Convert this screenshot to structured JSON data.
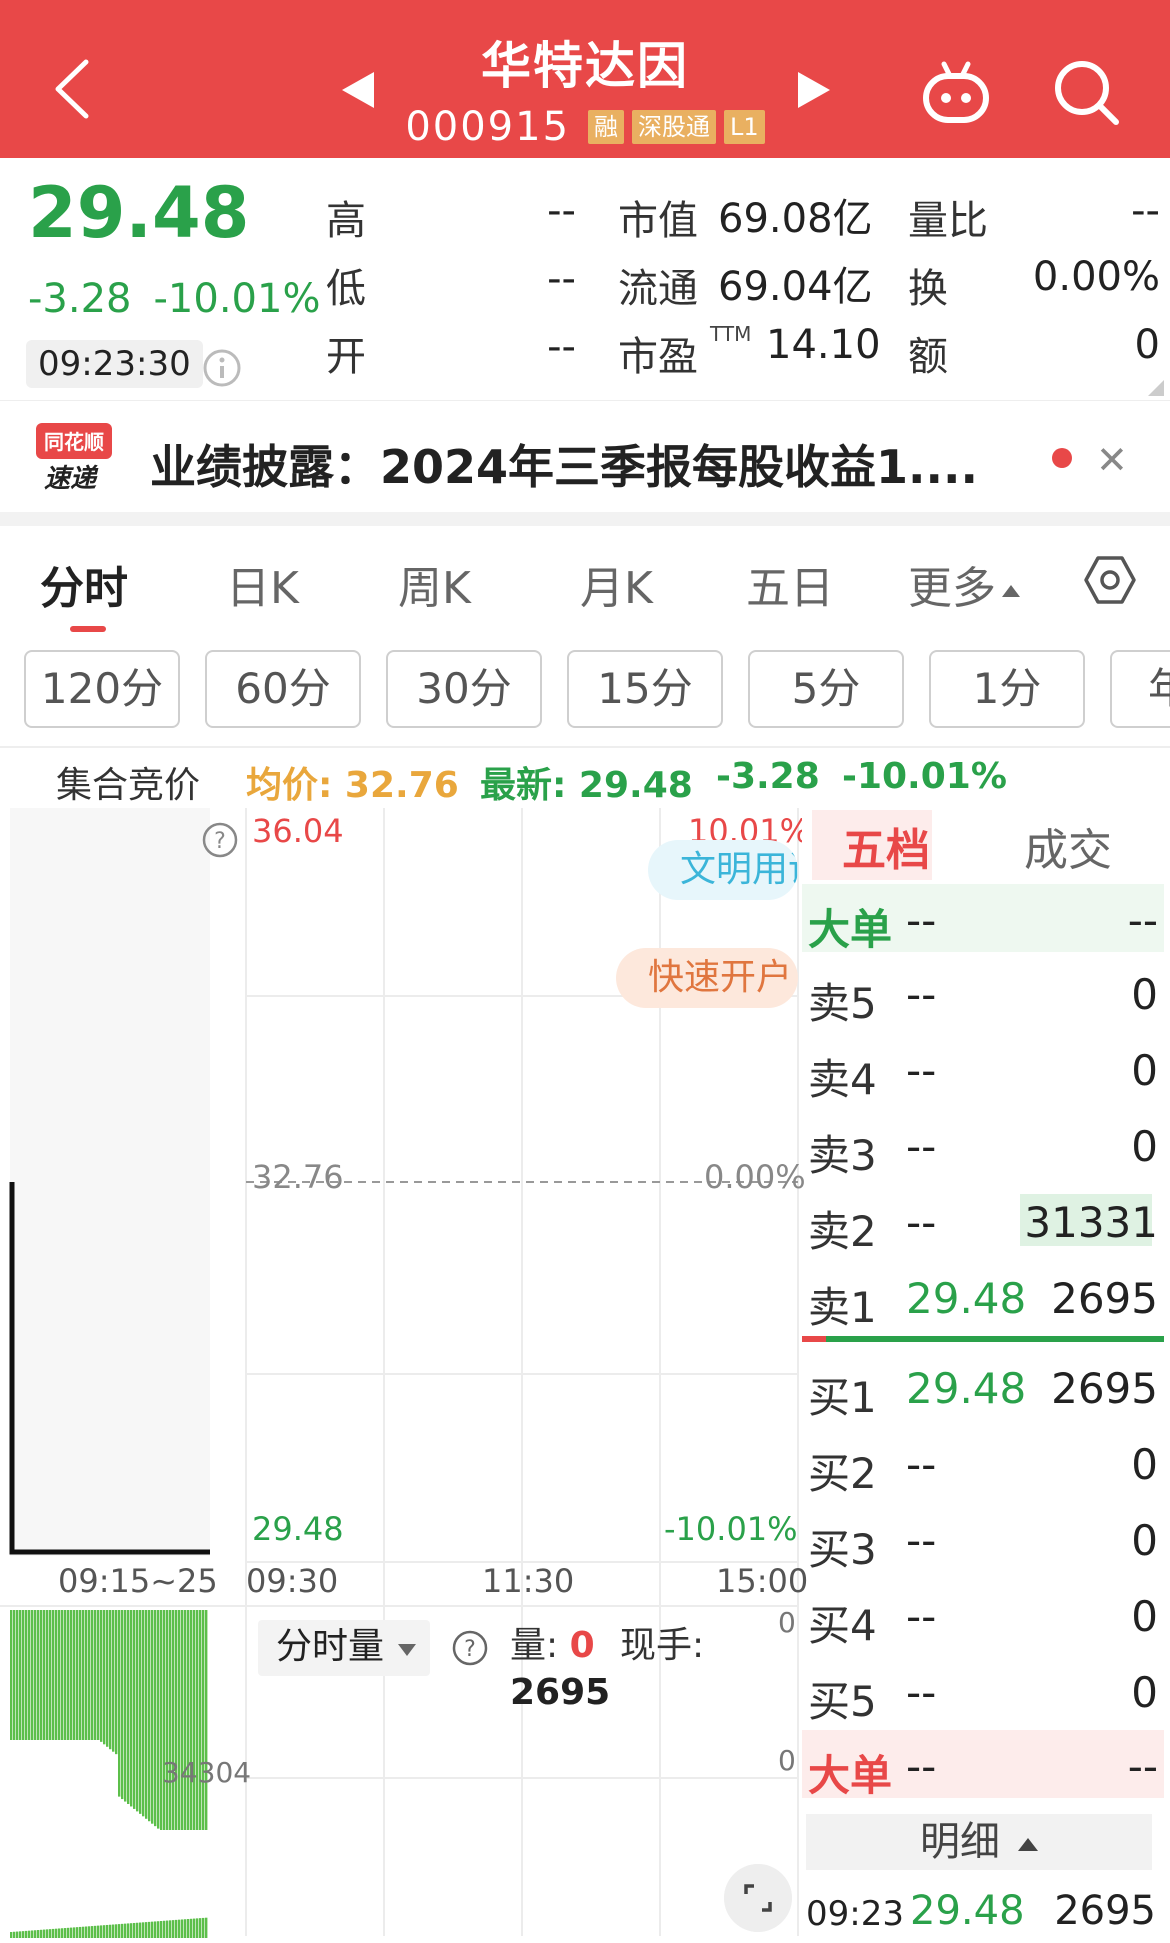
{
  "header": {
    "title": "华特达因",
    "code": "000915",
    "badges": [
      "融",
      "深股通",
      "L1"
    ],
    "bg_color": "#e84848"
  },
  "quote": {
    "price": "29.48",
    "change": "-3.28",
    "change_pct": "-10.01%",
    "time": "09:23:30",
    "fields": [
      {
        "label": "高",
        "value": "--"
      },
      {
        "label": "低",
        "value": "--"
      },
      {
        "label": "开",
        "value": "--"
      },
      {
        "label": "市值",
        "value": "69.08亿"
      },
      {
        "label": "流通",
        "value": "69.04亿"
      },
      {
        "label": "市盈",
        "sup": "TTM",
        "value": "14.10"
      },
      {
        "label": "量比",
        "value": "--"
      },
      {
        "label": "换",
        "value": "0.00%"
      },
      {
        "label": "额",
        "value": "0"
      }
    ],
    "down_color": "#2aa14a"
  },
  "news": {
    "logo_top": "同花顺",
    "logo_bottom": "速递",
    "text": "业绩披露：2024年三季报每股收益1...."
  },
  "period_tabs": [
    "分时",
    "日K",
    "周K",
    "月K",
    "五日",
    "更多"
  ],
  "minute_buttons": [
    "120分",
    "60分",
    "30分",
    "15分",
    "5分",
    "1分",
    "年"
  ],
  "avg_row": {
    "label": "集合竞价",
    "avg": "均价: 32.76",
    "latest": "最新: 29.48",
    "chg": "-3.28",
    "pct": "-10.01%"
  },
  "chart": {
    "y_top": "36.04",
    "y_mid": "32.76",
    "y_bottom": "29.48",
    "pct_top": "10.01%",
    "pct_mid": "0.00%",
    "pct_bottom": "-10.01%",
    "times": [
      "09:15~25",
      "09:30",
      "11:30",
      "15:00"
    ],
    "pill_1": "文明用语",
    "pill_2": "快速开户",
    "vol_label_auction": "34304",
    "vol_axis_top": "0",
    "vol_axis_mid": "0"
  },
  "chart_data": {
    "type": "line",
    "title": "",
    "x": [
      "09:15~25",
      "09:30",
      "11:30",
      "15:00"
    ],
    "ylim": [
      29.48,
      36.04
    ],
    "pct_range": [
      "-10.01%",
      "10.01%"
    ],
    "reference_price": 32.76,
    "series": [
      {
        "name": "",
        "values": [
          29.48
        ]
      }
    ]
  },
  "volume": {
    "selector": "分时量",
    "vol_label": "量: ",
    "vol_value": "0",
    "hand_label": "现手: ",
    "hand_value": "2695"
  },
  "orderbook": {
    "tabs": [
      "五档",
      "成交"
    ],
    "big_sell": {
      "name": "大单",
      "price": "--",
      "vol": "--"
    },
    "sells": [
      {
        "name": "卖5",
        "price": "--",
        "vol": "0"
      },
      {
        "name": "卖4",
        "price": "--",
        "vol": "0"
      },
      {
        "name": "卖3",
        "price": "--",
        "vol": "0"
      },
      {
        "name": "卖2",
        "price": "--",
        "vol": "31331"
      },
      {
        "name": "卖1",
        "price": "29.48",
        "vol": "2695"
      }
    ],
    "buys": [
      {
        "name": "买1",
        "price": "29.48",
        "vol": "2695"
      },
      {
        "name": "买2",
        "price": "--",
        "vol": "0"
      },
      {
        "name": "买3",
        "price": "--",
        "vol": "0"
      },
      {
        "name": "买4",
        "price": "--",
        "vol": "0"
      },
      {
        "name": "买5",
        "price": "--",
        "vol": "0"
      }
    ],
    "big_buy": {
      "name": "大单",
      "price": "--",
      "vol": "--"
    },
    "detail": "明细",
    "last_trade": {
      "time": "09:23",
      "price": "29.48",
      "vol": "2695"
    }
  }
}
